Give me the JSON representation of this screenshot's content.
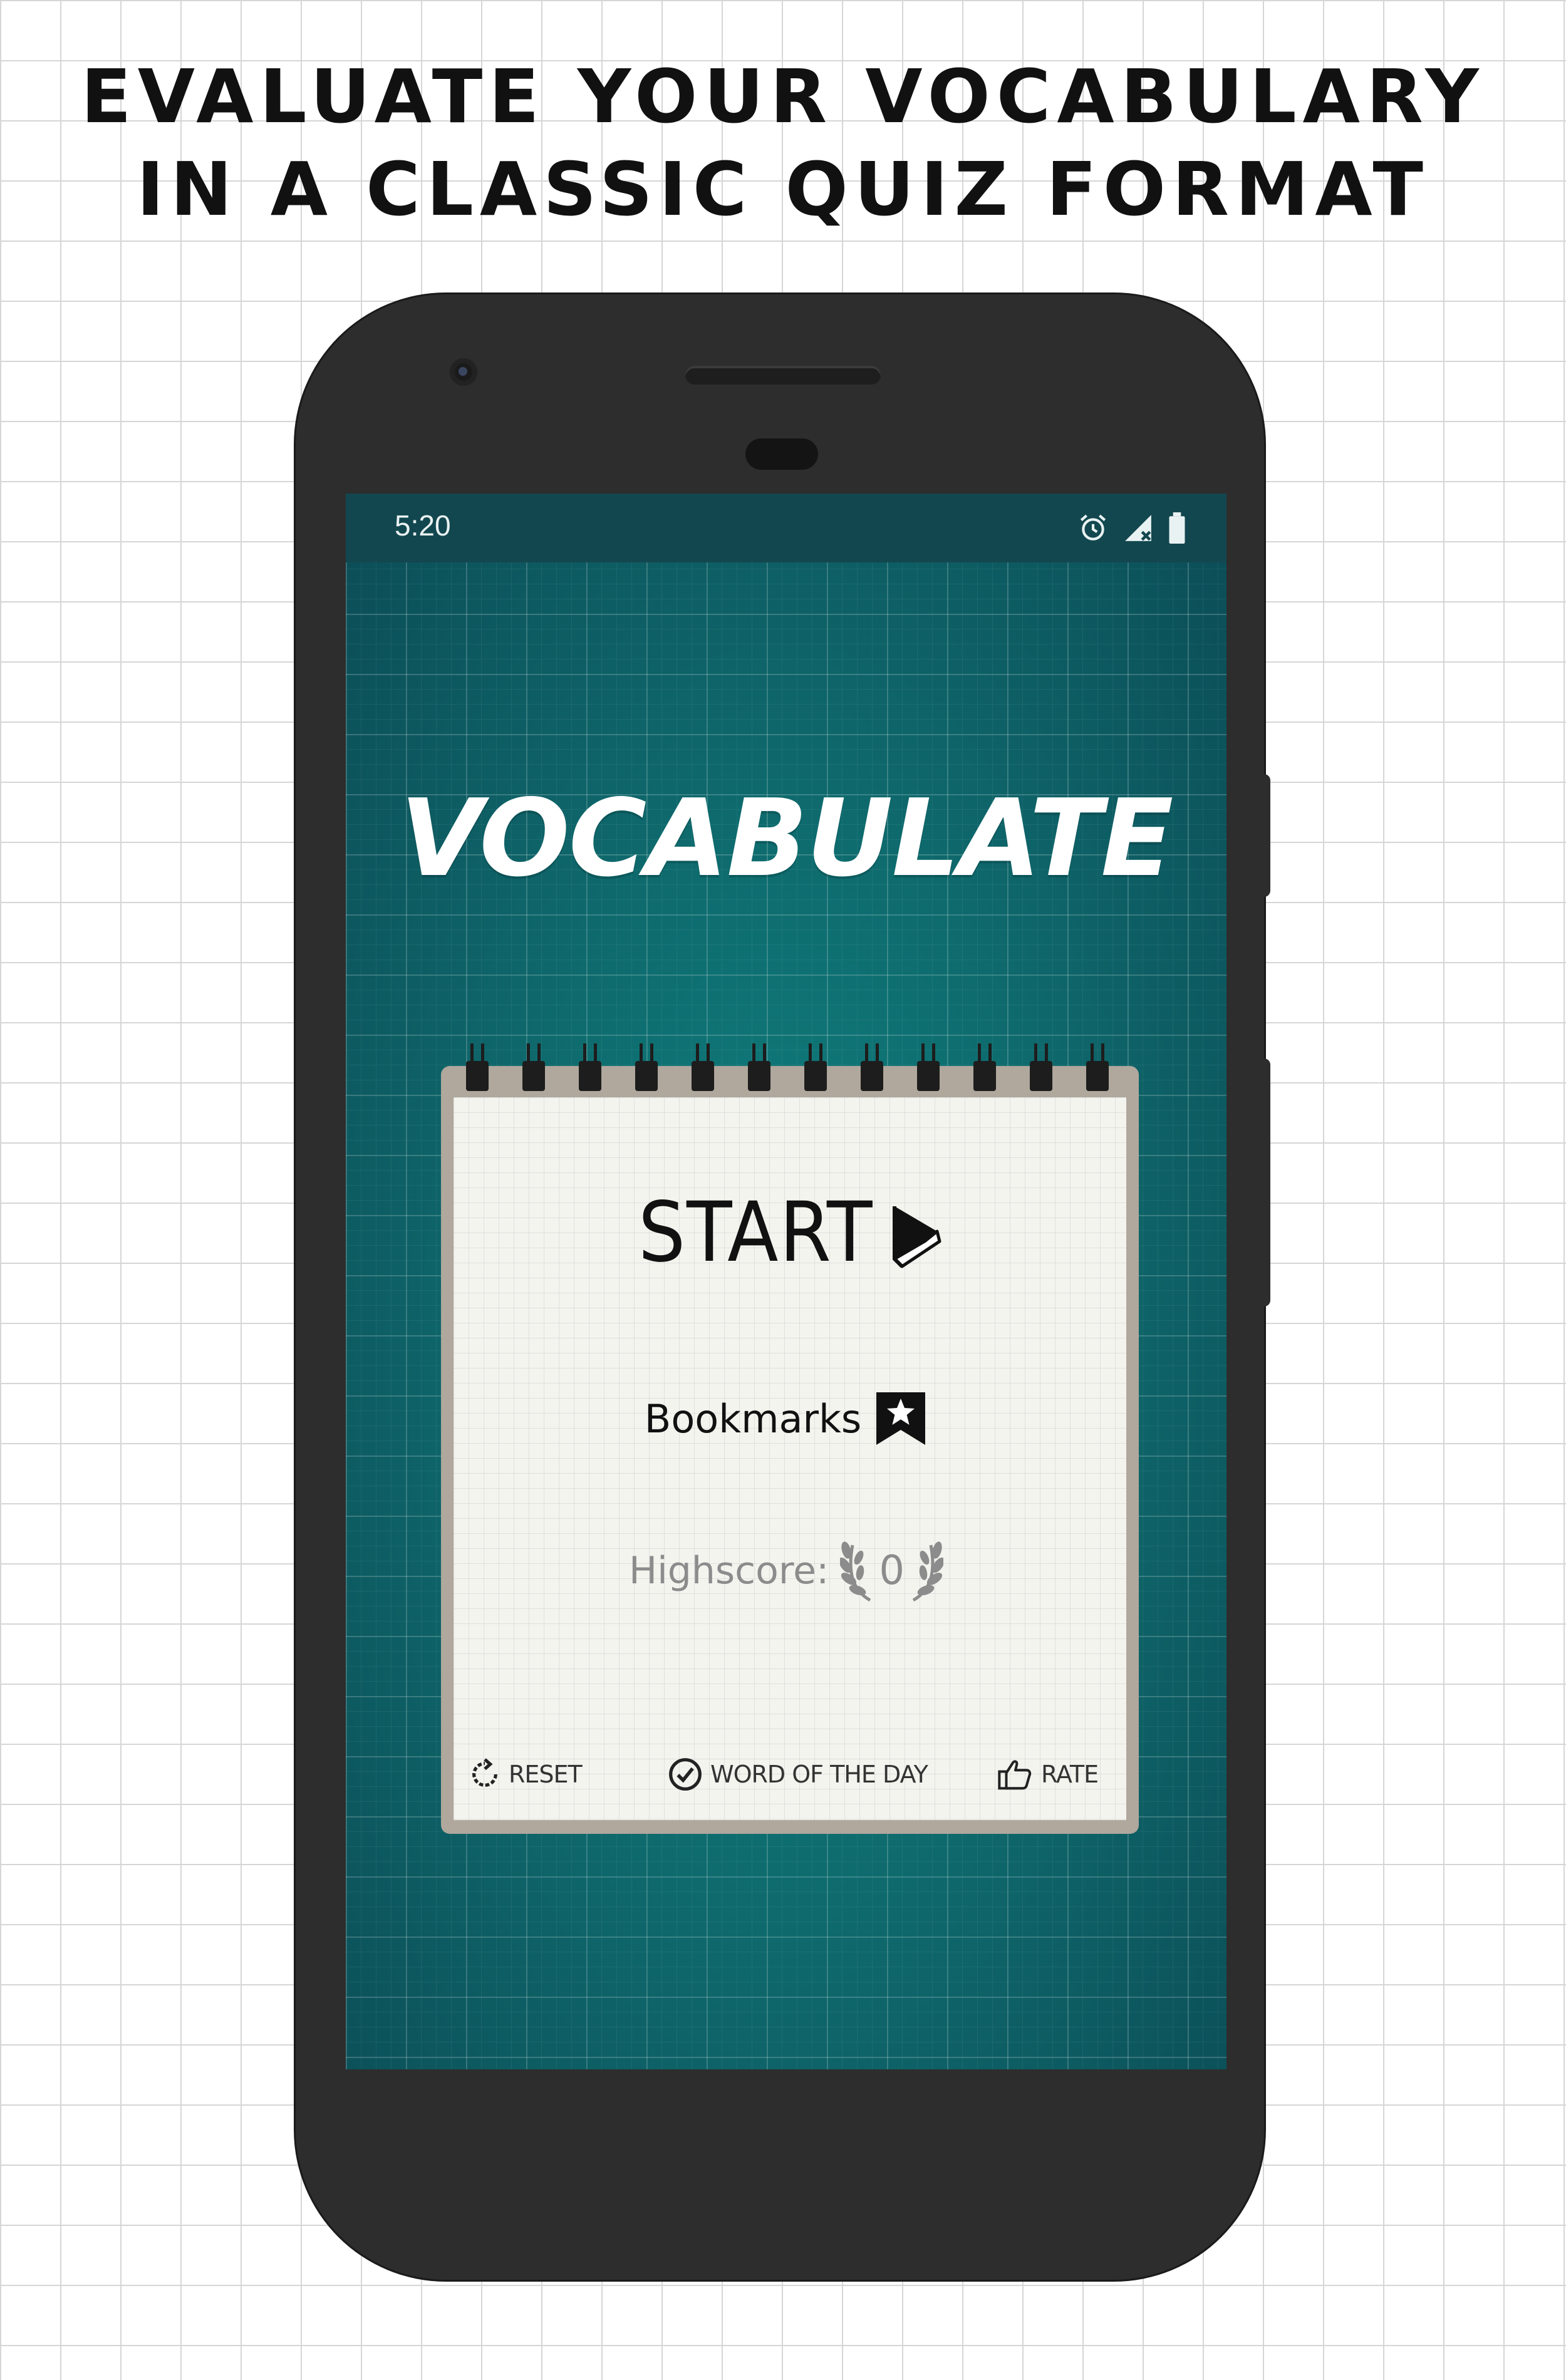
{
  "headline": {
    "line1": "EVALUATE YOUR VOCABULARY",
    "line2": "IN A CLASSIC QUIZ FORMAT"
  },
  "status_bar": {
    "time": "5:20",
    "icons": [
      "alarm-icon",
      "signal-icon",
      "battery-icon"
    ]
  },
  "app": {
    "title": "VOCABULATE",
    "start_label": "START",
    "bookmarks_label": "Bookmarks",
    "highscore_label": "Highscore:",
    "highscore_value": "0"
  },
  "actions": {
    "reset": "RESET",
    "word_of_the_day": "WORD OF THE DAY",
    "rate": "RATE"
  },
  "colors": {
    "screen_bg": "#0e6a6d",
    "status_bar": "#13474f",
    "paper": "#f4f4ef",
    "phone": "#2d2d2d"
  }
}
